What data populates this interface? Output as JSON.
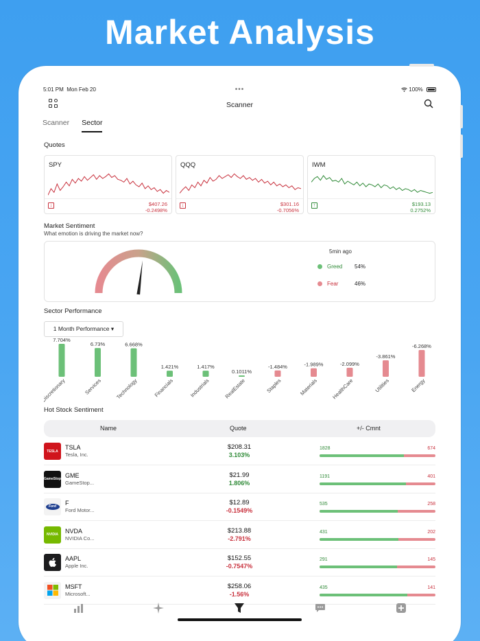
{
  "hero_title": "Market Analysis",
  "status": {
    "time": "5:01 PM",
    "date": "Mon Feb 20",
    "battery": "100%"
  },
  "nav": {
    "title": "Scanner"
  },
  "tabs": [
    {
      "label": "Scanner",
      "active": false
    },
    {
      "label": "Sector",
      "active": true
    }
  ],
  "quotes": {
    "label": "Quotes",
    "items": [
      {
        "symbol": "SPY",
        "price": "$407.26",
        "change": "-0.2498%",
        "trend": "down",
        "color": "#c8303c"
      },
      {
        "symbol": "QQQ",
        "price": "$301.16",
        "change": "-0.7056%",
        "trend": "down",
        "color": "#c8303c"
      },
      {
        "symbol": "IWM",
        "price": "$193.13",
        "change": "0.2752%",
        "trend": "up",
        "color": "#2f8a37"
      }
    ]
  },
  "sentiment": {
    "title": "Market Sentiment",
    "subtitle": "What emotion is driving the market now?",
    "updated": "5min ago",
    "greed": {
      "label": "Greed",
      "value": "54%",
      "fraction": 0.54,
      "color": "#6cc078"
    },
    "fear": {
      "label": "Fear",
      "value": "46%",
      "fraction": 0.46,
      "color": "#e58a90"
    }
  },
  "sector_performance": {
    "title": "Sector Performance",
    "period": "1 Month Performance",
    "chart_data": {
      "type": "bar",
      "categories": [
        "Discretionary",
        "Services",
        "Technology",
        "Financials",
        "Industrials",
        "RealEstate",
        "Staples",
        "Materials",
        "HealthCare",
        "Utilities",
        "Energy"
      ],
      "values": [
        7.704,
        6.73,
        6.668,
        1.421,
        1.417,
        0.1011,
        -1.484,
        -1.989,
        -2.099,
        -3.861,
        -6.268
      ],
      "labels": [
        "7.704%",
        "6.73%",
        "6.668%",
        "1.421%",
        "1.417%",
        "0.1011%",
        "-1.484%",
        "-1.989%",
        "-2.099%",
        "-3.861%",
        "-6.268%"
      ],
      "positive_color": "#6cc078",
      "negative_color": "#e58a90"
    }
  },
  "hot_stocks": {
    "title": "Hot Stock Sentiment",
    "columns": [
      "Name",
      "Quote",
      "+/- Cmnt"
    ],
    "rows": [
      {
        "ticker": "TSLA",
        "name": "Tesla, Inc.",
        "price": "$208.31",
        "change": "3.103%",
        "dir": "up",
        "pos": "1828",
        "neg": "674",
        "logo": "TESLA",
        "logo_bg": "#d0141c"
      },
      {
        "ticker": "GME",
        "name": "GameStop...",
        "price": "$21.99",
        "change": "1.806%",
        "dir": "up",
        "pos": "1191",
        "neg": "401",
        "logo": "GameStop",
        "logo_bg": "#111111"
      },
      {
        "ticker": "F",
        "name": "Ford Motor...",
        "price": "$12.89",
        "change": "-0.1549%",
        "dir": "down",
        "pos": "535",
        "neg": "258",
        "logo": "Ford",
        "logo_bg": "#f3f3f3"
      },
      {
        "ticker": "NVDA",
        "name": "NVIDIA Co...",
        "price": "$213.88",
        "change": "-2.791%",
        "dir": "down",
        "pos": "431",
        "neg": "202",
        "logo": "NVIDIA",
        "logo_bg": "#76b900"
      },
      {
        "ticker": "AAPL",
        "name": "Apple Inc.",
        "price": "$152.55",
        "change": "-0.7547%",
        "dir": "down",
        "pos": "291",
        "neg": "145",
        "logo": "",
        "logo_bg": "#1c1c1e"
      },
      {
        "ticker": "MSFT",
        "name": "Microsoft...",
        "price": "$258.06",
        "change": "-1.56%",
        "dir": "down",
        "pos": "435",
        "neg": "141",
        "logo": "",
        "logo_bg": "#f3f3f3"
      }
    ]
  },
  "tabbar": [
    "chart-bars-icon",
    "sparkle-icon",
    "filter-icon",
    "chat-bubble-icon",
    "plus-square-icon"
  ]
}
